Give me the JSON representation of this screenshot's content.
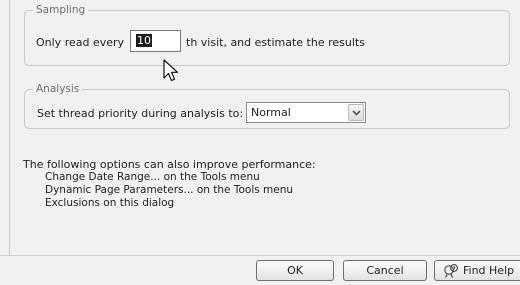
{
  "sampling": {
    "legend": "Sampling",
    "label_before": "Only read every",
    "visit_value": "10",
    "label_after": "th visit, and estimate the results"
  },
  "analysis": {
    "legend": "Analysis",
    "thread_label": "Set thread priority during analysis to:",
    "thread_priority": "Normal"
  },
  "performance": {
    "heading": "The following options can also improve performance:",
    "items": [
      "Change Date Range... on the Tools menu",
      "Dynamic Page Parameters... on the Tools menu",
      "Exclusions on this dialog"
    ]
  },
  "buttons": {
    "ok": "OK",
    "cancel": "Cancel",
    "find_help": "Find Help"
  },
  "icons": {
    "cursor": "mouse-pointer-icon",
    "dropdown": "chevron-down-icon",
    "help": "help-icon"
  }
}
